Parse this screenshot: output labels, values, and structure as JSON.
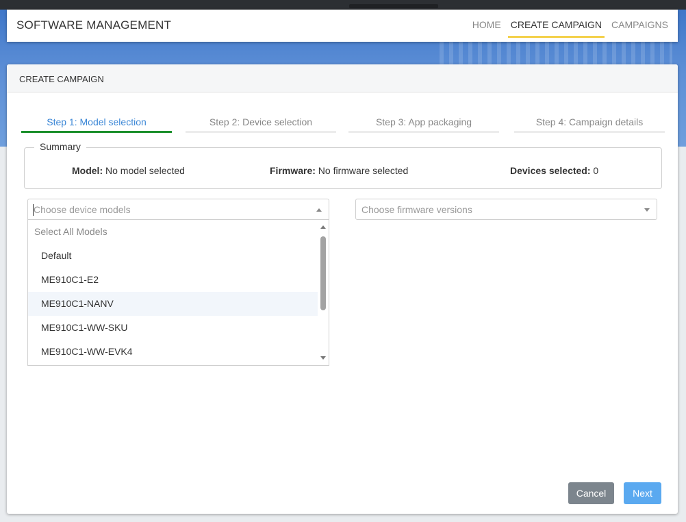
{
  "app": {
    "title": "SOFTWARE MANAGEMENT"
  },
  "nav": {
    "home": "HOME",
    "create_campaign": "CREATE CAMPAIGN",
    "campaigns": "CAMPAIGNS",
    "active": "CREATE CAMPAIGN"
  },
  "card": {
    "title": "CREATE CAMPAIGN"
  },
  "steps": [
    {
      "label": "Step 1: Model selection",
      "active": true
    },
    {
      "label": "Step 2: Device selection",
      "active": false
    },
    {
      "label": "Step 3: App packaging",
      "active": false
    },
    {
      "label": "Step 4: Campaign details",
      "active": false
    }
  ],
  "summary": {
    "legend": "Summary",
    "model_label": "Model:",
    "model_value": " No model selected",
    "firmware_label": "Firmware:",
    "firmware_value": " No firmware selected",
    "devices_label": "Devices selected:",
    "devices_value": " 0"
  },
  "models_select": {
    "placeholder": "Choose device models",
    "select_all": "Select All Models",
    "options": [
      "Default",
      "ME910C1-E2",
      "ME910C1-NANV",
      "ME910C1-WW-SKU",
      "ME910C1-WW-EVK4"
    ],
    "hovered": "ME910C1-NANV"
  },
  "firmware_select": {
    "placeholder": "Choose firmware versions"
  },
  "buttons": {
    "cancel": "Cancel",
    "next": "Next"
  },
  "colors": {
    "accent_underline": "#f0c419",
    "active_step": "#1a8f2a",
    "primary": "#5aa9f0",
    "secondary": "#7c858d"
  }
}
